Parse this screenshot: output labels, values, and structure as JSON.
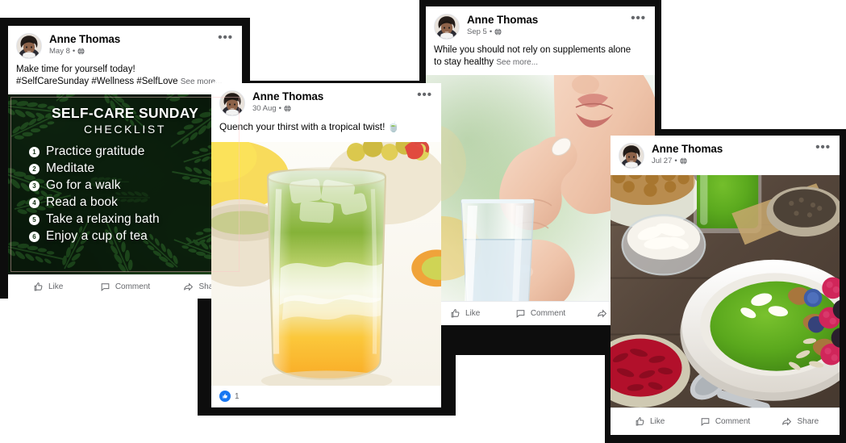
{
  "author": "Anne Thomas",
  "icons": {
    "more": "ellipsis-icon",
    "globe": "globe-privacy-icon",
    "like": "thumbs-up-icon",
    "comment": "comment-bubble-icon",
    "share": "share-arrow-icon"
  },
  "action_labels": {
    "like": "Like",
    "comment": "Comment",
    "share": "Share"
  },
  "posts": [
    {
      "id": "self-care-sunday",
      "author": "Anne Thomas",
      "date": "May 8",
      "more": "•••",
      "text_line1": "Make time for yourself today!",
      "text_line2": "#SelfCareSunday #Wellness #SelfLove",
      "see_more": "See more...",
      "image_alt": "self-care-sunday-checklist-graphic",
      "checklist": {
        "title": "SELF-CARE SUNDAY",
        "subtitle": "CHECKLIST",
        "items": [
          {
            "num": "1",
            "label": "Practice gratitude"
          },
          {
            "num": "2",
            "label": "Meditate"
          },
          {
            "num": "3",
            "label": "Go for a walk"
          },
          {
            "num": "4",
            "label": "Read a book"
          },
          {
            "num": "5",
            "label": "Take a relaxing bath"
          },
          {
            "num": "6",
            "label": "Enjoy a cup of tea"
          }
        ]
      }
    },
    {
      "id": "tropical-twist",
      "author": "Anne Thomas",
      "date": "30 Aug",
      "more": "•••",
      "text_line1": "Quench your thirst with a tropical twist! 🍵",
      "image_alt": "layered-matcha-mango-iced-drink-photo",
      "reaction_count": "1"
    },
    {
      "id": "supplements",
      "author": "Anne Thomas",
      "date": "Sep 5",
      "more": "•••",
      "text_line1": "While you should not rely on supplements alone",
      "text_line2": "to stay healthy",
      "see_more": "See more...",
      "image_alt": "woman-taking-supplement-with-glass-of-water-photo"
    },
    {
      "id": "smoothie-bowl",
      "author": "Anne Thomas",
      "date": "Jul 27",
      "more": "•••",
      "image_alt": "green-smoothie-bowl-with-berries-and-nuts-photo"
    }
  ],
  "colors": {
    "frame": "#0d0d0d",
    "card": "#ffffff",
    "text": "#050505",
    "muted": "#65676b",
    "reaction_blue": "#1877f2"
  }
}
